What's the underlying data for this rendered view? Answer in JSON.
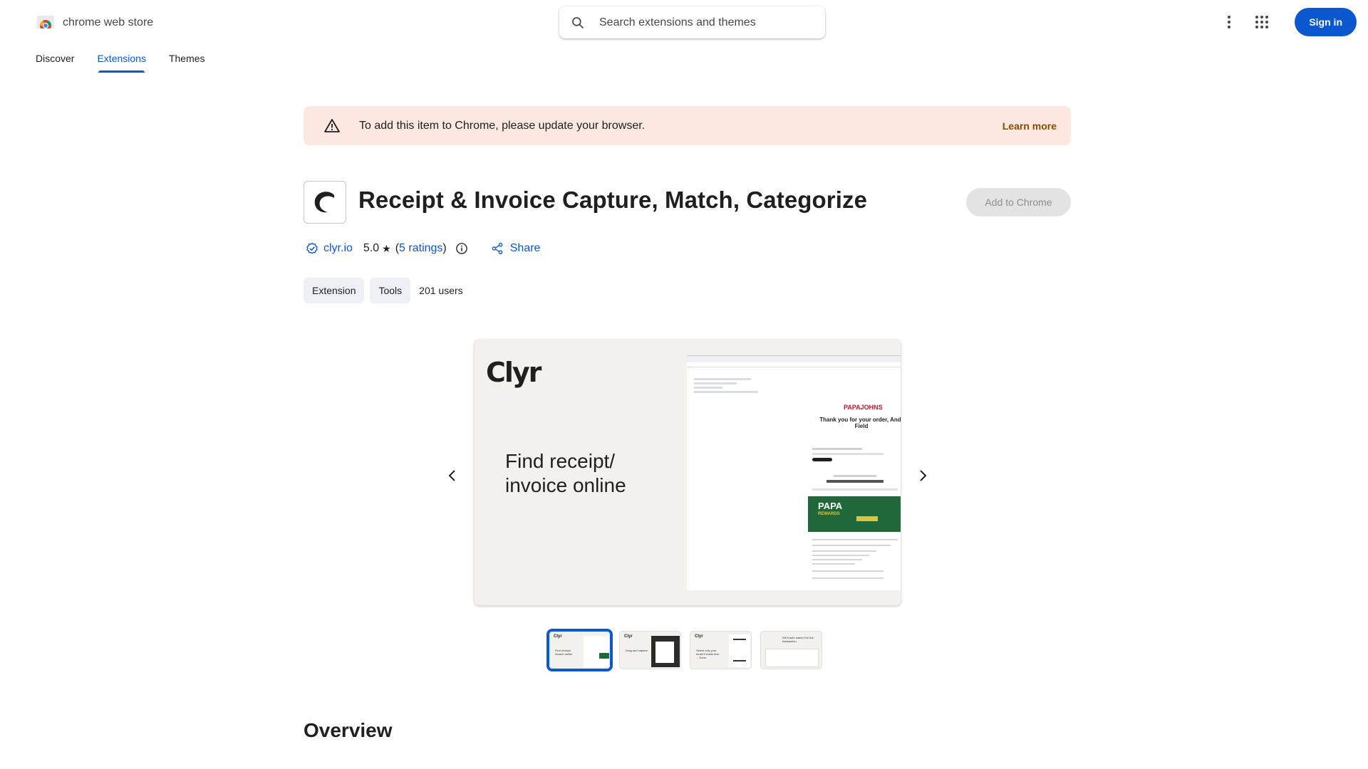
{
  "header": {
    "brand": "chrome web store",
    "search_placeholder": "Search extensions and themes",
    "sign_in": "Sign in"
  },
  "nav": {
    "items": [
      {
        "label": "Discover",
        "active": false
      },
      {
        "label": "Extensions",
        "active": true
      },
      {
        "label": "Themes",
        "active": false
      }
    ]
  },
  "banner": {
    "message": "To add this item to Chrome, please update your browser.",
    "link": "Learn more"
  },
  "extension": {
    "title": "Receipt & Invoice Capture, Match, Categorize",
    "add_button": "Add to Chrome",
    "publisher": "clyr.io",
    "rating": "5.0",
    "ratings_open": "(",
    "ratings_link": "5 ratings",
    "ratings_close": ")",
    "share": "Share",
    "chips": [
      "Extension",
      "Tools"
    ],
    "users": "201 users"
  },
  "slide": {
    "brand": "Clyr",
    "caption_line1": "Find receipt/",
    "caption_line2": "invoice online",
    "email_logo": "PAPAJOHNS",
    "email_thanks": "Thank you for your order, Andr Field",
    "rewards_title": "PAPA",
    "rewards_sub": "REWARDS"
  },
  "thumbnails": [
    {
      "brand": "Clyr",
      "caption": "Find receipt/ invoice online",
      "active": true
    },
    {
      "brand": "Clyr",
      "caption": "Drag and capture.",
      "active": false
    },
    {
      "brand": "Clyr",
      "caption": "Select only your email if exists first. ... Done.",
      "active": false
    },
    {
      "brand": "",
      "caption": "We'll auto-match it to the transaction.",
      "active": false
    }
  ],
  "section": {
    "overview": "Overview"
  },
  "colors": {
    "accent": "#0b57d0",
    "banner_bg": "#fce8e0",
    "banner_link": "#8a4a00",
    "disabled_btn": "#e3e3e3"
  }
}
